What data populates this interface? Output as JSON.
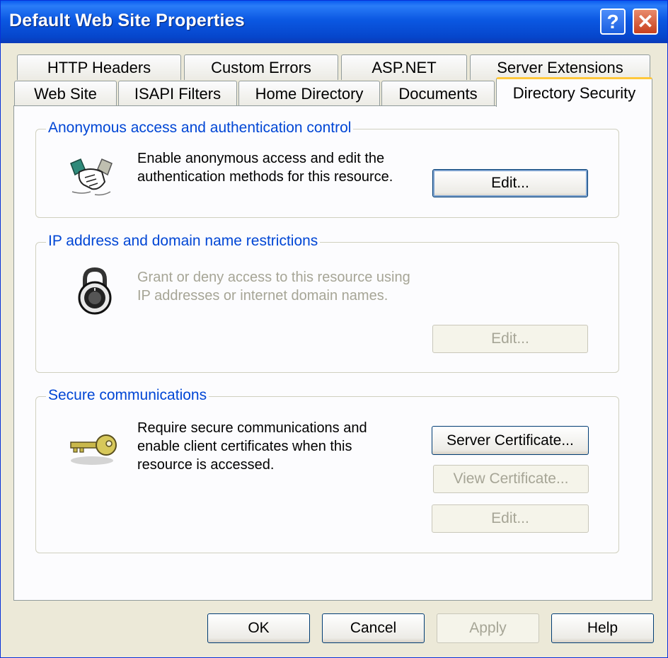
{
  "window": {
    "title": "Default Web Site Properties"
  },
  "titlebar": {
    "help_label": "?",
    "close_label": "✕"
  },
  "tabs": {
    "back_row": [
      "HTTP Headers",
      "Custom Errors",
      "ASP.NET",
      "Server Extensions"
    ],
    "front_row": [
      "Web Site",
      "ISAPI Filters",
      "Home Directory",
      "Documents",
      "Directory Security"
    ],
    "active": "Directory Security"
  },
  "sections": {
    "anonymous": {
      "legend": "Anonymous access and authentication control",
      "description_line1": "Enable anonymous access and edit the",
      "description_line2": "authentication methods for this resource.",
      "edit_label": "Edit...",
      "icon": "handshake-icon"
    },
    "ip_restrictions": {
      "legend": "IP address and domain name restrictions",
      "description_line1": "Grant or deny access to this resource using",
      "description_line2": "IP addresses or internet domain names.",
      "edit_label": "Edit...",
      "icon": "padlock-icon"
    },
    "secure": {
      "legend": "Secure communications",
      "description_line1": "Require secure communications and",
      "description_line2": "enable client certificates when this",
      "description_line3": "resource is accessed.",
      "server_cert_label": "Server Certificate...",
      "view_cert_label": "View Certificate...",
      "edit_label": "Edit...",
      "icon": "key-icon"
    }
  },
  "footer": {
    "ok_label": "OK",
    "cancel_label": "Cancel",
    "apply_label": "Apply",
    "help_label": "Help"
  },
  "colors": {
    "accent": "#0046d5",
    "active_tab_highlight": "#ffc83c",
    "titlebar": "#0646cc"
  }
}
